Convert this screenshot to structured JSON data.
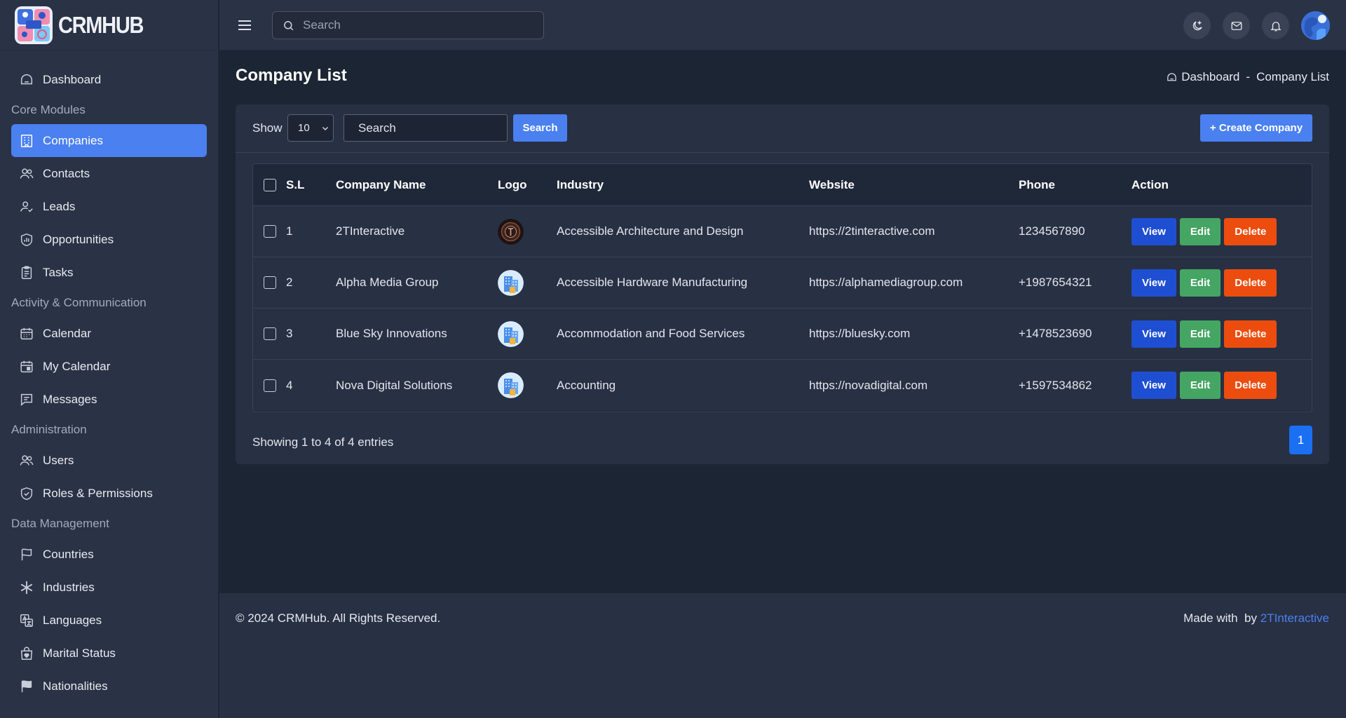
{
  "brand": {
    "name": "CRMHUB",
    "logo_text": "CRM"
  },
  "sidebar": {
    "items": [
      {
        "label": "Dashboard",
        "icon": "dashboard-icon"
      },
      {
        "section": "Core Modules"
      },
      {
        "label": "Companies",
        "icon": "building-icon",
        "active": true
      },
      {
        "label": "Contacts",
        "icon": "users-icon"
      },
      {
        "label": "Leads",
        "icon": "user-check-icon"
      },
      {
        "label": "Opportunities",
        "icon": "chart-shield-icon"
      },
      {
        "label": "Tasks",
        "icon": "clipboard-icon"
      },
      {
        "section": "Activity & Communication"
      },
      {
        "label": "Calendar",
        "icon": "calendar-icon"
      },
      {
        "label": "My Calendar",
        "icon": "calendar-check-icon"
      },
      {
        "label": "Messages",
        "icon": "message-icon"
      },
      {
        "section": "Administration"
      },
      {
        "label": "Users",
        "icon": "users-icon"
      },
      {
        "label": "Roles & Permissions",
        "icon": "shield-check-icon"
      },
      {
        "section": "Data Management"
      },
      {
        "label": "Countries",
        "icon": "flag-icon"
      },
      {
        "label": "Industries",
        "icon": "asterisk-icon"
      },
      {
        "label": "Languages",
        "icon": "language-icon"
      },
      {
        "label": "Marital Status",
        "icon": "bag-heart-icon"
      },
      {
        "label": "Nationalities",
        "icon": "flag-filled-icon"
      }
    ]
  },
  "topbar": {
    "search_placeholder": "Search"
  },
  "page": {
    "title": "Company List",
    "breadcrumb": {
      "home": "Dashboard",
      "separator": "-",
      "current": "Company List"
    }
  },
  "toolbar": {
    "show_label": "Show",
    "page_size": "10",
    "search_placeholder": "Search",
    "search_button": "Search",
    "create_button": "+ Create Company"
  },
  "table": {
    "headers": {
      "sl": "S.L",
      "name": "Company Name",
      "logo": "Logo",
      "industry": "Industry",
      "website": "Website",
      "phone": "Phone",
      "action": "Action"
    },
    "rows": [
      {
        "sl": "1",
        "name": "2TInteractive",
        "logo": "dark-emblem",
        "industry": "Accessible Architecture and Design",
        "website": "https://2tinteractive.com",
        "phone": "1234567890"
      },
      {
        "sl": "2",
        "name": "Alpha Media Group",
        "logo": "building-logo",
        "industry": "Accessible Hardware Manufacturing",
        "website": "https://alphamediagroup.com",
        "phone": "+1987654321"
      },
      {
        "sl": "3",
        "name": "Blue Sky Innovations",
        "logo": "building-logo",
        "industry": "Accommodation and Food Services",
        "website": "https://bluesky.com",
        "phone": "+1478523690"
      },
      {
        "sl": "4",
        "name": "Nova Digital Solutions",
        "logo": "building-logo",
        "industry": "Accounting",
        "website": "https://novadigital.com",
        "phone": "+1597534862"
      }
    ],
    "actions": {
      "view": "View",
      "edit": "Edit",
      "delete": "Delete"
    }
  },
  "pagination": {
    "summary": "Showing 1 to 4 of 4 entries",
    "current_page": "1"
  },
  "footer": {
    "copyright": "© 2024 CRMHub. All Rights Reserved.",
    "made_with": "Made with  by",
    "made_by": "2TInteractive"
  },
  "colors": {
    "accent": "#4a80f0",
    "view": "#1e4fd2",
    "edit": "#45a563",
    "delete": "#ec4d0f",
    "page_active": "#1a6ff2"
  }
}
